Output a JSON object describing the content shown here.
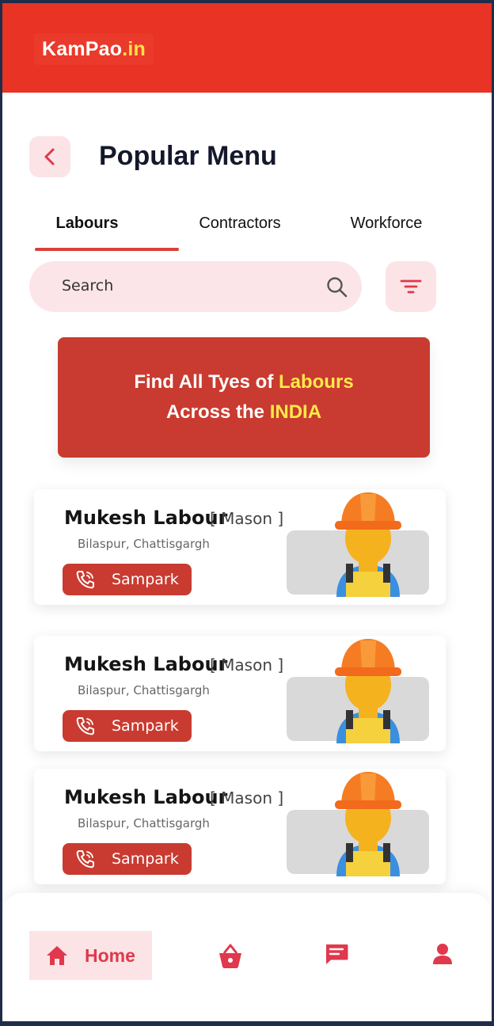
{
  "header": {
    "logo_main": "KamPao",
    "logo_tld": ".in",
    "brand_color": "#e83325"
  },
  "page": {
    "title": "Popular Menu"
  },
  "tabs": [
    {
      "label": "Labours",
      "active": true
    },
    {
      "label": "Contractors",
      "active": false
    },
    {
      "label": "Workforce",
      "active": false
    }
  ],
  "search": {
    "placeholder": "Search",
    "icon": "search-icon",
    "filter_icon": "filter-icon"
  },
  "banner": {
    "line1_prefix": "Find All Tyes of ",
    "line1_highlight": "Labours",
    "line2_prefix": "Across the ",
    "line2_highlight": "INDIA",
    "background": "#c93b30",
    "highlight_color": "#ffe94a"
  },
  "labours": [
    {
      "name": "Mukesh Labour",
      "role": "[ Mason ]",
      "location": "Bilaspur, Chattisgargh",
      "action": "Sampark"
    },
    {
      "name": "Mukesh Labour",
      "role": "[ Mason ]",
      "location": "Bilaspur, Chattisgargh",
      "action": "Sampark"
    },
    {
      "name": "Mukesh Labour",
      "role": "[ Mason ]",
      "location": "Bilaspur, Chattisgargh",
      "action": "Sampark"
    }
  ],
  "bottom_nav": {
    "items": [
      {
        "label": "Home",
        "icon": "home-icon",
        "active": true
      },
      {
        "label": "",
        "icon": "basket-icon",
        "active": false
      },
      {
        "label": "",
        "icon": "message-icon",
        "active": false
      },
      {
        "label": "",
        "icon": "profile-icon",
        "active": false
      }
    ],
    "accent": "#e0384c"
  }
}
